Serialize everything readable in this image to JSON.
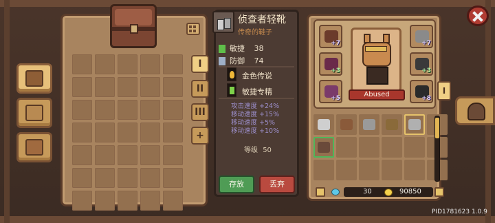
{
  "item": {
    "name": "侦查者轻靴",
    "rarity": "传奇的鞋子",
    "stats": [
      {
        "label": "敏捷",
        "value": "38",
        "icon": "agility-icon",
        "color": "#5fbf4a"
      },
      {
        "label": "防御",
        "value": "74",
        "icon": "shield-icon",
        "color": "#9fb0c8"
      }
    ],
    "perks": [
      {
        "label": "金色传说",
        "icon": "flame-icon"
      },
      {
        "label": "敏捷专精",
        "icon": "agility-perk-icon"
      }
    ],
    "bonuses": [
      "攻击速度 +24%",
      "移动速度 +15%",
      "移动速度 +5%",
      "移动速度 +10%"
    ],
    "level_label": "等级",
    "level_value": "50"
  },
  "actions": {
    "store_label": "存放",
    "discard_label": "丢弃"
  },
  "tabs": {
    "pages": [
      "I",
      "II",
      "III",
      "+"
    ],
    "side_tab": "I"
  },
  "character": {
    "name": "Abused",
    "equip_plus": [
      "+7",
      "+3",
      "+5",
      "+7",
      "+3",
      "+8"
    ]
  },
  "currency": {
    "gems": "30",
    "coins": "90850"
  },
  "footer": {
    "pid": "PID1781623 1.0.9"
  },
  "colors": {
    "store_button": "#4f9c55",
    "discard_button": "#b94a3f",
    "name_plate": "#a8362c",
    "bonus_text": "#9a8dc8"
  }
}
